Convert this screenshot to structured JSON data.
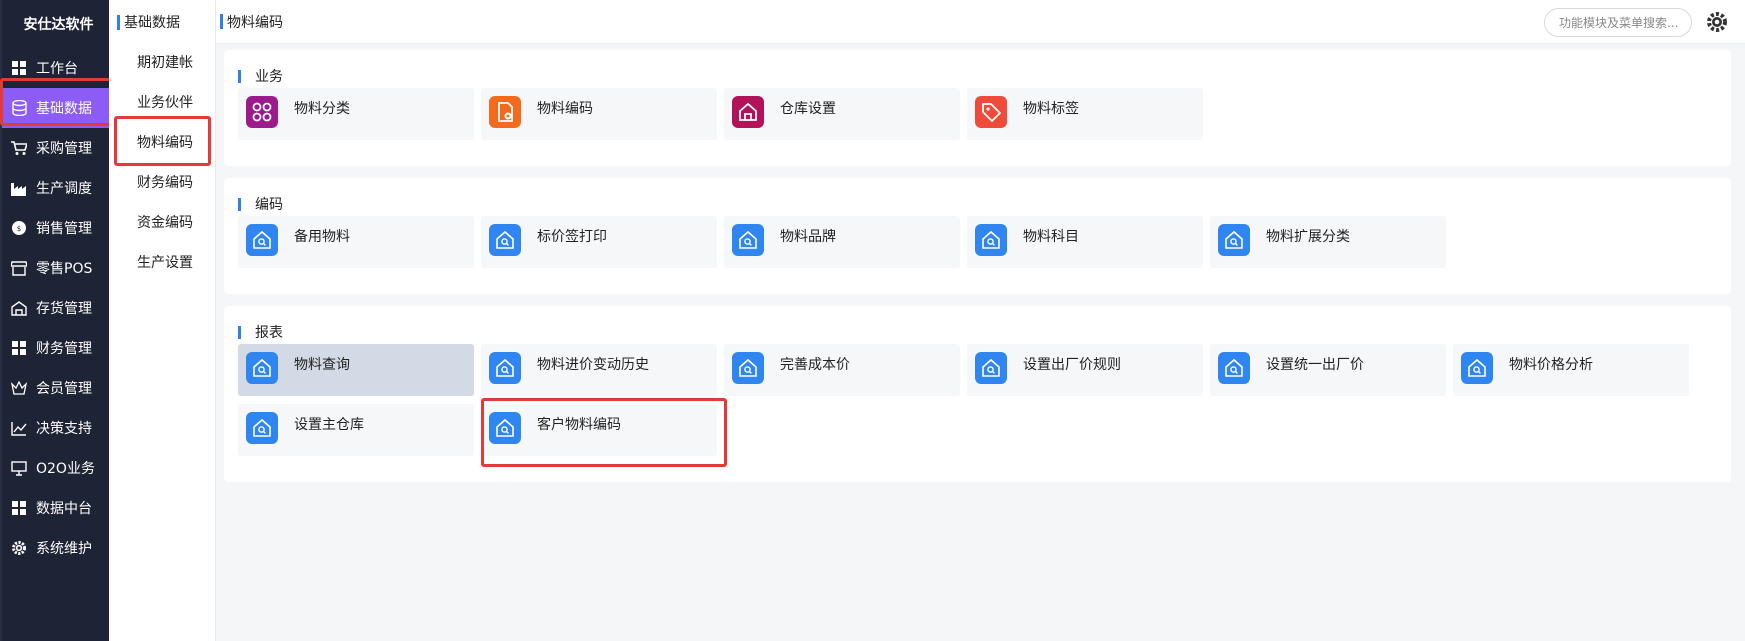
{
  "nav": {
    "brand": "安仕达软件",
    "items": [
      {
        "label": "工作台",
        "icon": "grid-icon"
      },
      {
        "label": "基础数据",
        "icon": "database-icon"
      },
      {
        "label": "采购管理",
        "icon": "cart-icon"
      },
      {
        "label": "生产调度",
        "icon": "factory-icon"
      },
      {
        "label": "销售管理",
        "icon": "sales-icon"
      },
      {
        "label": "零售POS",
        "icon": "store-icon"
      },
      {
        "label": "存货管理",
        "icon": "warehouse-icon"
      },
      {
        "label": "财务管理",
        "icon": "grid-icon"
      },
      {
        "label": "会员管理",
        "icon": "crown-icon"
      },
      {
        "label": "决策支持",
        "icon": "chart-icon"
      },
      {
        "label": "O2O业务",
        "icon": "monitor-icon"
      },
      {
        "label": "数据中台",
        "icon": "grid-icon"
      },
      {
        "label": "系统维护",
        "icon": "gear-icon"
      }
    ]
  },
  "submenu": {
    "title": "基础数据",
    "items": [
      "期初建帐",
      "业务伙伴",
      "物料编码",
      "财务编码",
      "资金编码",
      "生产设置"
    ]
  },
  "topbar": {
    "breadcrumb": "物料编码",
    "search_placeholder": "功能模块及菜单搜索..."
  },
  "colors": {
    "nav_bg": "#1f2336",
    "nav_active": "#8b5cf6",
    "accent_blue": "#2f80ed",
    "highlight_red": "#e53935"
  },
  "sections": [
    {
      "title": "业务",
      "tiles": [
        {
          "label": "物料分类",
          "icon": "category-icon",
          "color": "#9c1a8c"
        },
        {
          "label": "物料编码",
          "icon": "doc-gear-icon",
          "color": "#f26b1d"
        },
        {
          "label": "仓库设置",
          "icon": "house-icon",
          "color": "#b3125a"
        },
        {
          "label": "物料标签",
          "icon": "tag-icon",
          "color": "#ef4a3a"
        }
      ]
    },
    {
      "title": "编码",
      "tiles": [
        {
          "label": "备用物料",
          "icon": "house-search-icon",
          "color": "#2f86f0"
        },
        {
          "label": "标价签打印",
          "icon": "house-search-icon",
          "color": "#2f86f0"
        },
        {
          "label": "物料品牌",
          "icon": "house-search-icon",
          "color": "#2f86f0"
        },
        {
          "label": "物料科目",
          "icon": "house-search-icon",
          "color": "#2f86f0"
        },
        {
          "label": "物料扩展分类",
          "icon": "house-search-icon",
          "color": "#2f86f0"
        }
      ]
    },
    {
      "title": "报表",
      "tiles": [
        {
          "label": "物料查询",
          "icon": "house-search-icon",
          "color": "#2f86f0"
        },
        {
          "label": "物料进价变动历史",
          "icon": "house-search-icon",
          "color": "#2f86f0"
        },
        {
          "label": "完善成本价",
          "icon": "house-search-icon",
          "color": "#2f86f0"
        },
        {
          "label": "设置出厂价规则",
          "icon": "house-search-icon",
          "color": "#2f86f0"
        },
        {
          "label": "设置统一出厂价",
          "icon": "house-search-icon",
          "color": "#2f86f0"
        },
        {
          "label": "物料价格分析",
          "icon": "house-search-icon",
          "color": "#2f86f0"
        },
        {
          "label": "设置主仓库",
          "icon": "house-search-icon",
          "color": "#2f86f0"
        },
        {
          "label": "客户物料编码",
          "icon": "house-search-icon",
          "color": "#2f86f0"
        }
      ]
    }
  ]
}
